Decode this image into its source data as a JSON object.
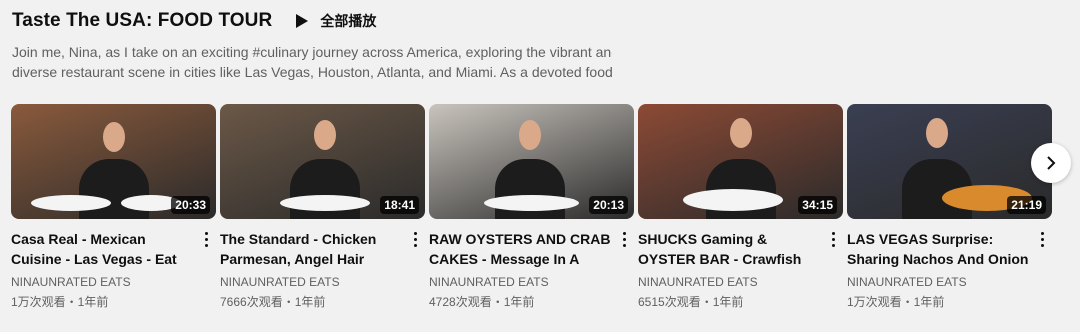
{
  "shelf": {
    "title": "Taste The USA: FOOD TOUR",
    "play_all_label": "全部播放",
    "description_line1": "Join me, Nina, as I take on an exciting #culinary journey across America, exploring the vibrant and",
    "description_line2": "diverse restaurant scene in cities like Las Vegas, Houston, Atlanta, and Miami. As a devoted food…"
  },
  "videos": [
    {
      "title": "Casa Real - Mexican Cuisine - Las Vegas - Eat With Me",
      "channel": "NINAUNRATED EATS",
      "stats": "1万次观看・1年前",
      "duration": "20:33",
      "bg": "#8a5a3c",
      "accent": "#c4302b"
    },
    {
      "title": "The Standard - Chicken Parmesan, Angel Hair Pasta…",
      "channel": "NINAUNRATED EATS",
      "stats": "7666次观看・1年前",
      "duration": "18:41",
      "bg": "#6b5847",
      "accent": "#b8733a"
    },
    {
      "title": "RAW OYSTERS AND CRAB CAKES - Message In A Bottle",
      "channel": "NINAUNRATED EATS",
      "stats": "4728次观看・1年前",
      "duration": "20:13",
      "bg": "#c9c4bd",
      "accent": "#7a8a5a"
    },
    {
      "title": "SHUCKS Gaming & OYSTER BAR - Crawfish Boil, Raw…",
      "channel": "NINAUNRATED EATS",
      "stats": "6515次观看・1年前",
      "duration": "34:15",
      "bg": "#8c4a35",
      "accent": "#6b4a3a"
    },
    {
      "title": "LAS VEGAS Surprise: Sharing Nachos And Onion Rings…",
      "channel": "NINAUNRATED EATS",
      "stats": "1万次观看・1年前",
      "duration": "21:19",
      "bg": "#3a3f52",
      "accent": "#d98a2c"
    }
  ]
}
